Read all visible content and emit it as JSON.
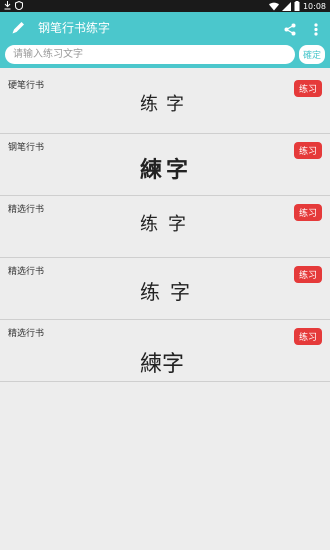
{
  "statusbar": {
    "time": "10:08"
  },
  "toolbar": {
    "title": "钢笔行书练字"
  },
  "search": {
    "placeholder": "请输入练习文字",
    "value": "",
    "confirm_label": "確定"
  },
  "items": [
    {
      "label": "硬笔行书",
      "sample": "练字",
      "button": "练习"
    },
    {
      "label": "钢笔行书",
      "sample": "練字",
      "button": "练习"
    },
    {
      "label": "精选行书",
      "sample": "练字",
      "button": "练习"
    },
    {
      "label": "精选行书",
      "sample": "练字",
      "button": "练习"
    },
    {
      "label": "精选行书",
      "sample": "練字",
      "button": "练习"
    }
  ],
  "colors": {
    "accent": "#4bc7cc",
    "practice": "#e53a3a",
    "background": "#ededed"
  },
  "icons": [
    "download-icon",
    "shield-icon",
    "wifi-icon",
    "signal-icon",
    "battery-icon",
    "pen-icon",
    "share-icon",
    "more-vert-icon"
  ]
}
